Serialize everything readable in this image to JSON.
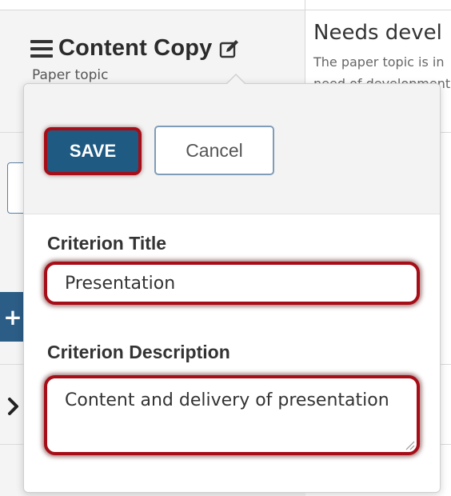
{
  "criterion": {
    "name": "Content Copy",
    "description": "Paper topic"
  },
  "rating": {
    "title": "Needs devel",
    "description": "The paper topic is in need of development"
  },
  "editor": {
    "save_label": "SAVE",
    "cancel_label": "Cancel",
    "title_label": "Criterion Title",
    "title_value": "Presentation",
    "description_label": "Criterion Description",
    "description_value": "Content and delivery of presentation"
  },
  "colors": {
    "primary": "#1e5a82",
    "highlight": "#a60d17"
  },
  "icons": {
    "menu": "hamburger-icon",
    "edit": "edit-icon",
    "add": "plus-icon",
    "expand": "chevron-right-icon"
  }
}
